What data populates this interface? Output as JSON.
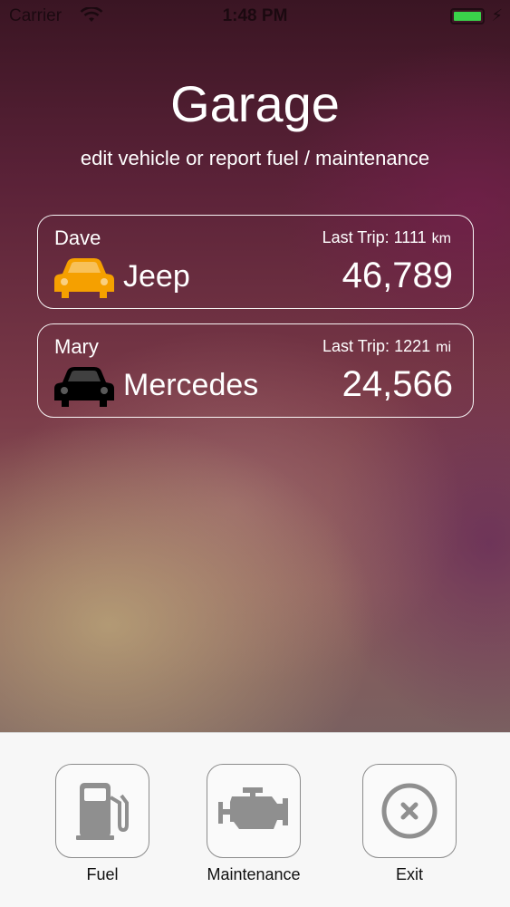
{
  "status_bar": {
    "carrier": "Carrier",
    "time": "1:48 PM",
    "battery_color": "#3ad34a"
  },
  "header": {
    "title": "Garage",
    "subtitle": "edit vehicle or report fuel / maintenance"
  },
  "vehicles": [
    {
      "owner": "Dave",
      "trip_label": "Last Trip: 1111",
      "trip_unit": "km",
      "model": "Jeep",
      "odometer": "46,789",
      "icon": "car-icon",
      "icon_color": "#f5a000"
    },
    {
      "owner": "Mary",
      "trip_label": "Last Trip: 1221",
      "trip_unit": "mi",
      "model": "Mercedes",
      "odometer": "24,566",
      "icon": "car-icon",
      "icon_color": "#000000"
    }
  ],
  "toolbar": {
    "fuel_label": "Fuel",
    "maintenance_label": "Maintenance",
    "exit_label": "Exit",
    "icon_color": "#8f8f8f"
  }
}
